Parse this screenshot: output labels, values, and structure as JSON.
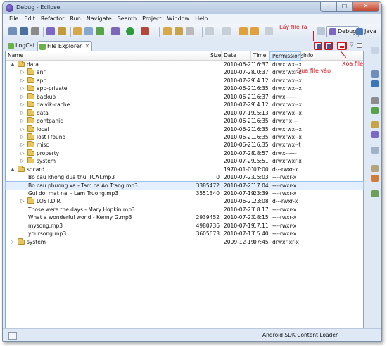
{
  "window": {
    "title": "Debug - Eclipse",
    "minimize": "–",
    "maximize": "□",
    "close": "✕"
  },
  "menu": [
    "File",
    "Edit",
    "Refactor",
    "Run",
    "Navigate",
    "Search",
    "Project",
    "Window",
    "Help"
  ],
  "perspectives": {
    "debug": "Debug",
    "java": "Java"
  },
  "tabs": {
    "logcat": "LogCat",
    "file_explorer": "File Explorer",
    "close": "✕"
  },
  "columns": {
    "name": "Name",
    "size": "Size",
    "date": "Date",
    "time": "Time",
    "permissions": "Permissions",
    "info": "Info"
  },
  "rows": [
    {
      "level": 0,
      "arrow": "▲",
      "folder": true,
      "name": "data",
      "size": "",
      "date": "2010-06-21",
      "time": "16:37",
      "perm": "drwxrwx--x"
    },
    {
      "level": 1,
      "arrow": "▷",
      "folder": true,
      "name": "anr",
      "size": "",
      "date": "2010-07-28",
      "time": "10:37",
      "perm": "drwxrwxr-x"
    },
    {
      "level": 1,
      "arrow": "▷",
      "folder": true,
      "name": "app",
      "size": "",
      "date": "2010-07-29",
      "time": "14:12",
      "perm": "drwxrwx--x"
    },
    {
      "level": 1,
      "arrow": "▷",
      "folder": true,
      "name": "app-private",
      "size": "",
      "date": "2010-06-21",
      "time": "16:35",
      "perm": "drwxrwx--x"
    },
    {
      "level": 1,
      "arrow": "▷",
      "folder": true,
      "name": "backup",
      "size": "",
      "date": "2010-06-21",
      "time": "16:37",
      "perm": "drwx------"
    },
    {
      "level": 1,
      "arrow": "▷",
      "folder": true,
      "name": "dalvik-cache",
      "size": "",
      "date": "2010-07-29",
      "time": "14:12",
      "perm": "drwxrwx--x"
    },
    {
      "level": 1,
      "arrow": "▷",
      "folder": true,
      "name": "data",
      "size": "",
      "date": "2010-07-19",
      "time": "15:13",
      "perm": "drwxrwx--x"
    },
    {
      "level": 1,
      "arrow": "▷",
      "folder": true,
      "name": "dontpanic",
      "size": "",
      "date": "2010-06-21",
      "time": "16:35",
      "perm": "drwxr-x---"
    },
    {
      "level": 1,
      "arrow": "▷",
      "folder": true,
      "name": "local",
      "size": "",
      "date": "2010-06-21",
      "time": "16:35",
      "perm": "drwxrwx--x"
    },
    {
      "level": 1,
      "arrow": "▷",
      "folder": true,
      "name": "lost+found",
      "size": "",
      "date": "2010-06-21",
      "time": "16:35",
      "perm": "drwxrwx--x"
    },
    {
      "level": 1,
      "arrow": "▷",
      "folder": true,
      "name": "misc",
      "size": "",
      "date": "2010-06-21",
      "time": "16:35",
      "perm": "drwxrwx--t"
    },
    {
      "level": 1,
      "arrow": "▷",
      "folder": true,
      "name": "property",
      "size": "",
      "date": "2010-07-28",
      "time": "18:57",
      "perm": "drwx------"
    },
    {
      "level": 1,
      "arrow": "▷",
      "folder": true,
      "name": "system",
      "size": "",
      "date": "2010-07-29",
      "time": "15:51",
      "perm": "drwxrwxr-x"
    },
    {
      "level": 0,
      "arrow": "▲",
      "folder": true,
      "name": "sdcard",
      "size": "",
      "date": "1970-01-01",
      "time": "07:00",
      "perm": "d---rwxr-x"
    },
    {
      "level": 1,
      "arrow": "",
      "folder": false,
      "name": "Bo cau khong dua thu_TCAT.mp3",
      "size": "0",
      "date": "2010-07-23",
      "time": "15:03",
      "perm": "----rwxr-x"
    },
    {
      "level": 1,
      "arrow": "",
      "folder": false,
      "name": "Bo cau phuong xa - Tam ca Ao Trang.mp3",
      "size": "3385472",
      "date": "2010-07-21",
      "time": "17:04",
      "perm": "----rwxr-x",
      "selected": true
    },
    {
      "level": 1,
      "arrow": "",
      "folder": false,
      "name": "Gui doi mat nai - Lam Truong.mp3",
      "size": "3551340",
      "date": "2010-07-19",
      "time": "23:39",
      "perm": "----rwxr-x"
    },
    {
      "level": 1,
      "arrow": "▷",
      "folder": true,
      "name": "LOST.DIR",
      "size": "",
      "date": "2010-06-21",
      "time": "23:08",
      "perm": "d---rwxr-x"
    },
    {
      "level": 1,
      "arrow": "",
      "folder": false,
      "name": "Those were the days - Mary Hopkin.mp3",
      "size": "",
      "date": "2010-07-23",
      "time": "18:17",
      "perm": "----rwxr-x"
    },
    {
      "level": 1,
      "arrow": "",
      "folder": false,
      "name": "What a wonderful world - Kenny G.mp3",
      "size": "2939452",
      "date": "2010-07-23",
      "time": "18:15",
      "perm": "----rwxr-x"
    },
    {
      "level": 1,
      "arrow": "",
      "folder": false,
      "name": "mysong.mp3",
      "size": "4980736",
      "date": "2010-07-19",
      "time": "17:11",
      "perm": "----rwxr-x"
    },
    {
      "level": 1,
      "arrow": "",
      "folder": false,
      "name": "yoursong.mp3",
      "size": "3605673",
      "date": "2010-07-13",
      "time": "15:40",
      "perm": "----rwxr-x"
    },
    {
      "level": 0,
      "arrow": "▷",
      "folder": true,
      "name": "system",
      "size": "",
      "date": "2009-12-19",
      "time": "07:45",
      "perm": "drwxr-xr-x"
    }
  ],
  "status": {
    "text": "Android SDK Content Loader"
  },
  "annotations": {
    "pull": "Lấy file ra",
    "push": "Đưa file vào",
    "delete": "Xóa file"
  },
  "colors": {
    "annotation": "#e0141b",
    "folder": "#e8c55e",
    "selection": "#e3effd"
  }
}
